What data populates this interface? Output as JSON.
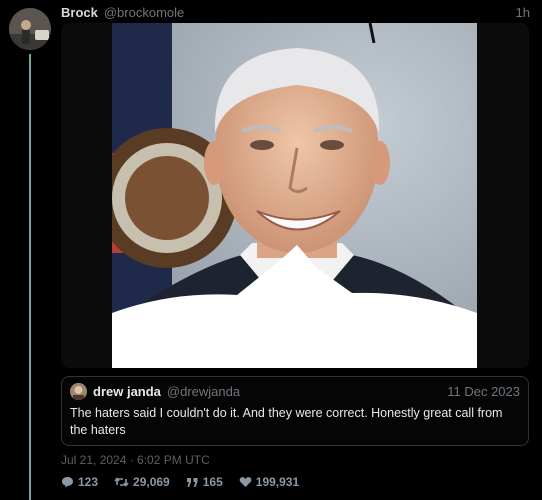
{
  "tweet": {
    "author_name": "Brock",
    "author_handle": "@brockomole",
    "timestamp": "1h",
    "avatar_icon": "user-photo-icon"
  },
  "quote": {
    "author_name": "drew janda",
    "author_handle": "@drewjanda",
    "date": "11 Dec 2023",
    "text": "The haters said I couldn't do it. And they were correct. Honestly great call from the haters"
  },
  "post_time": "Jul 21, 2024 · 6:02 PM UTC",
  "stats": {
    "replies": "123",
    "retweets": "29,069",
    "quotes": "165",
    "likes": "199,931"
  },
  "colors": {
    "background": "#000000",
    "thread_line": "#6ea8a6",
    "muted_text": "#6e767d"
  }
}
